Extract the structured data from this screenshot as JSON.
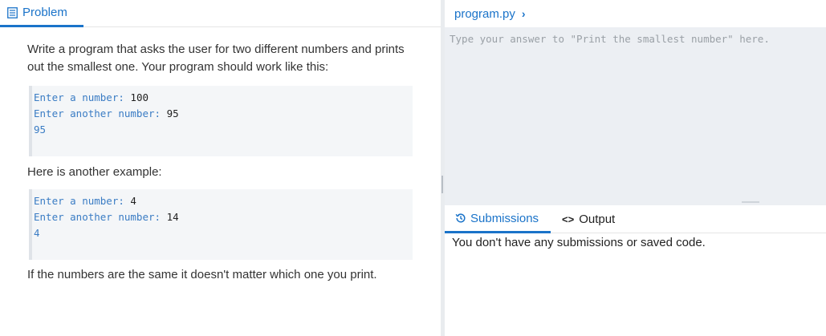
{
  "left": {
    "tab_label": "Problem",
    "paragraph1": "Write a program that asks the user for two different numbers and prints out the smallest one. Your program should work like this:",
    "example1": [
      {
        "prompt": "Enter a number: ",
        "input": "100"
      },
      {
        "prompt": "Enter another number: ",
        "input": "95"
      },
      {
        "output": "95"
      }
    ],
    "paragraph2": "Here is another example:",
    "example2": [
      {
        "prompt": "Enter a number: ",
        "input": "4"
      },
      {
        "prompt": "Enter another number: ",
        "input": "14"
      },
      {
        "output": "4"
      }
    ],
    "paragraph3": "If the numbers are the same it doesn't matter which one you print."
  },
  "right": {
    "file_name": "program.py",
    "file_chevron": "›",
    "editor_placeholder": "Type your answer to \"Print the smallest number\" here.",
    "tabs": {
      "submissions": "Submissions",
      "output": "Output",
      "output_icon": "<>"
    },
    "empty_message": "You don't have any submissions or saved code."
  },
  "colors": {
    "accent": "#1a73c9",
    "code_prompt": "#3a7cc4",
    "editor_bg": "#eceff3"
  },
  "icons": {
    "problem_tab": "document-icon",
    "submissions_tab": "history-icon",
    "output_tab": "code-icon"
  }
}
